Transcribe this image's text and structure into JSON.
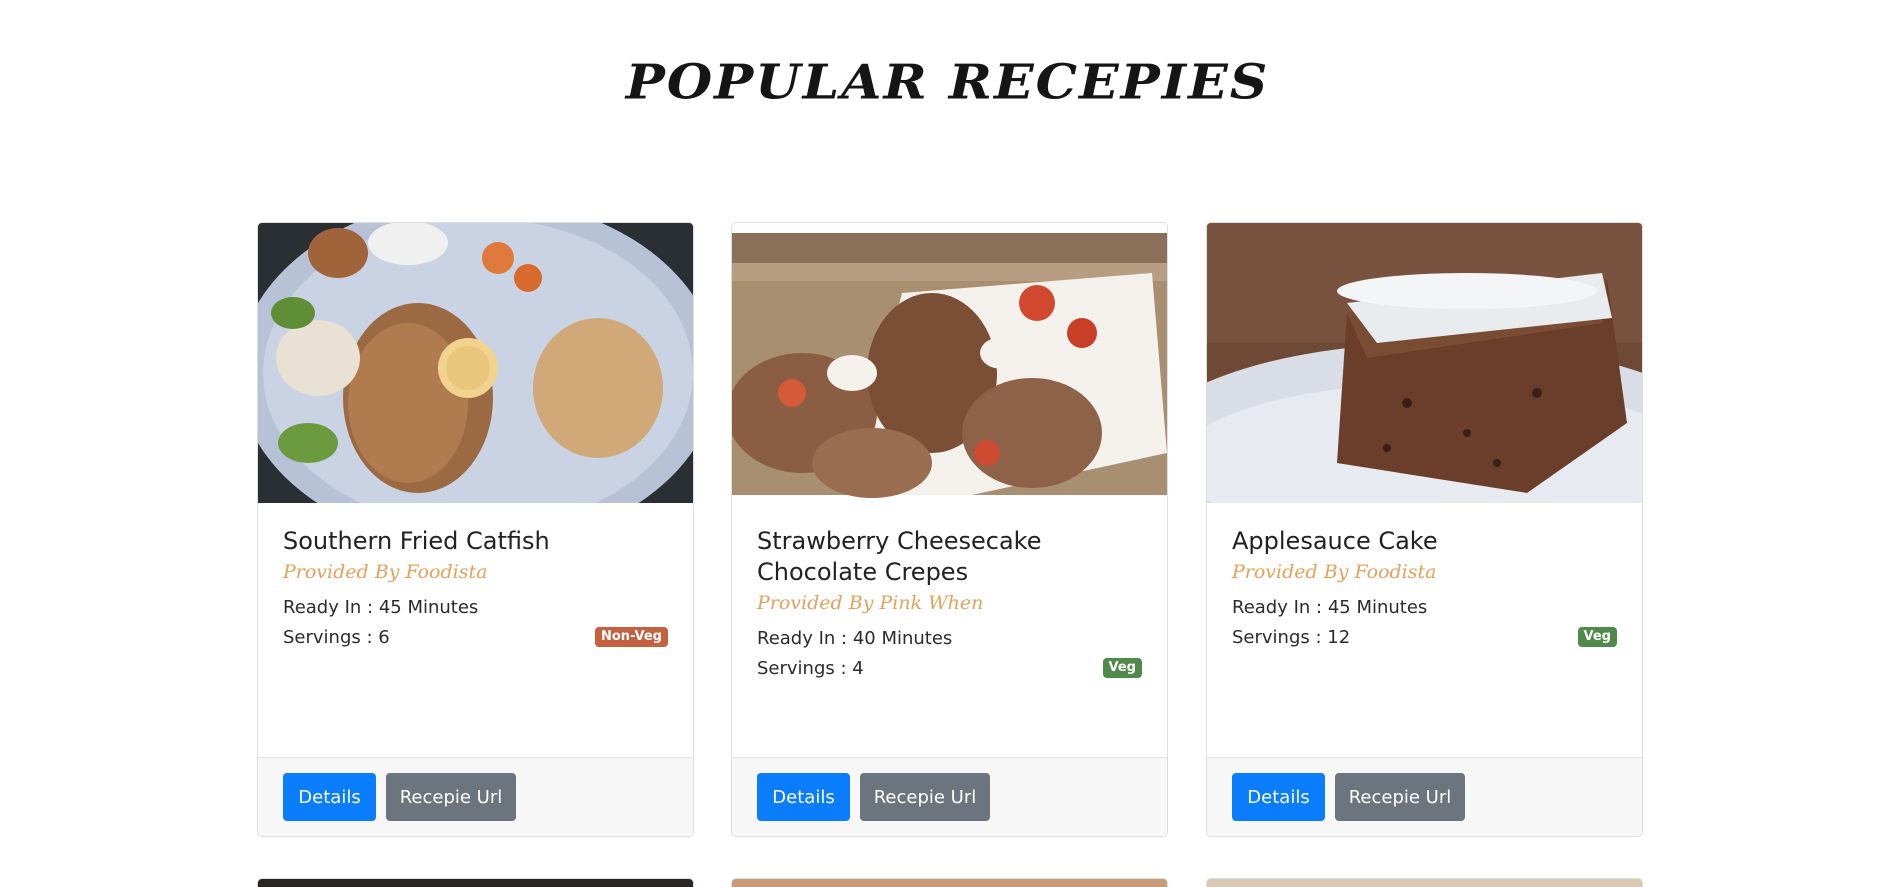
{
  "page": {
    "title": "POPULAR RECEPIES"
  },
  "recipes": [
    {
      "title": "Southern Fried Catfish",
      "provider": "Provided By Foodista",
      "ready": "Ready In : 45 Minutes",
      "servings": "Servings : 6",
      "badge": "Non-Veg",
      "badge_color": "#c4623f",
      "details_label": "Details",
      "url_label": "Recepie Url"
    },
    {
      "title": "Strawberry Cheesecake Chocolate Crepes",
      "provider": "Provided By Pink When",
      "ready": "Ready In : 40 Minutes",
      "servings": "Servings : 4",
      "badge": "Veg",
      "badge_color": "#4f8a4a",
      "details_label": "Details",
      "url_label": "Recepie Url"
    },
    {
      "title": "Applesauce Cake",
      "provider": "Provided By Foodista",
      "ready": "Ready In : 45 Minutes",
      "servings": "Servings : 12",
      "badge": "Veg",
      "badge_color": "#4f8a4a",
      "details_label": "Details",
      "url_label": "Recepie Url"
    }
  ],
  "colors": {
    "details_button": "#0a7dfc",
    "url_button": "#6c757d",
    "provider_text": "#e3a15a"
  }
}
